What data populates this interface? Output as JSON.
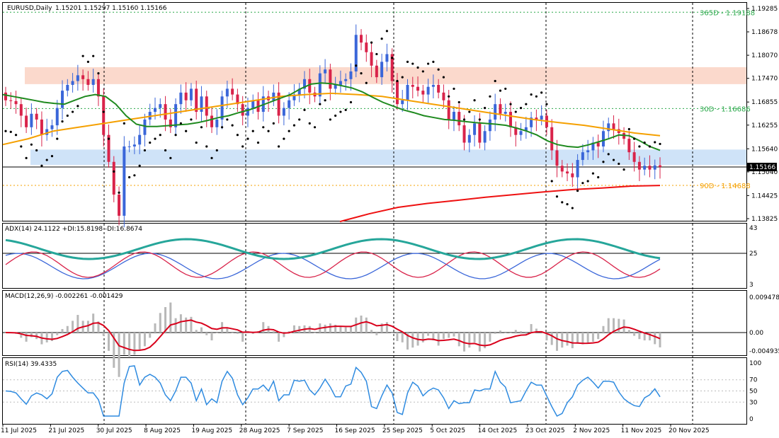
{
  "header": {
    "symbol_label": "EURUSD,Daily",
    "ohlc": "1.15201 1.15297 1.15160 1.15166"
  },
  "colors": {
    "bull": "#3a66d9",
    "bear": "#d9234a",
    "ma_green": "#1f8a1f",
    "ma_orange": "#f5a000",
    "ma_red": "#e11",
    "sar": "#000000",
    "zone_red": "#fbd9cc",
    "zone_blue": "#cfe3f8",
    "adx": "#26a69a",
    "plus_di": "#d9234a",
    "minus_di": "#3a66d9",
    "macd_hist": "#b8b8b8",
    "macd_signal": "#d9001b",
    "rsi": "#2f8be0",
    "level_365": "#2aa84a",
    "level_30": "#2aa84a",
    "level_90": "#f5a000"
  },
  "price_axis": {
    "ticks": [
      "1.19285",
      "1.18678",
      "1.18070",
      "1.17470",
      "1.16855",
      "1.16255",
      "1.15640",
      "1.15040",
      "1.14425",
      "1.13825"
    ],
    "current_price": "1.15166"
  },
  "levels": [
    {
      "label": "365D - 1.19188",
      "value": 1.19188,
      "color": "#2aa84a"
    },
    {
      "label": "30D - 1.16686",
      "value": 1.16686,
      "color": "#2aa84a"
    },
    {
      "label": "90D - 1.14688",
      "value": 1.14688,
      "color": "#f5a000"
    }
  ],
  "zones": [
    {
      "name": "resistance",
      "from": 1.1732,
      "to": 1.1776
    },
    {
      "name": "support",
      "from": 1.1522,
      "to": 1.1562
    }
  ],
  "x_axis": {
    "dates": [
      "11 Jul 2025",
      "21 Jul 2025",
      "30 Jul 2025",
      "8 Aug 2025",
      "19 Aug 2025",
      "28 Aug 2025",
      "7 Sep 2025",
      "16 Sep 2025",
      "25 Sep 2025",
      "5 Oct 2025",
      "14 Oct 2025",
      "23 Oct 2025",
      "2 Nov 2025",
      "11 Nov 2025",
      "20 Nov 2025"
    ]
  },
  "adx_panel": {
    "label": "ADX(14) 24.1122 +DI:15.8198 -DI:16.8674",
    "ticks": [
      "43",
      "25",
      "3"
    ]
  },
  "macd_panel": {
    "label": "MACD(12,26,9) -0.002261 -0.001429",
    "ticks": [
      "0.009478",
      "0.00",
      "-0.004935"
    ]
  },
  "rsi_panel": {
    "label": "RSI(14) 39.4335",
    "ticks": [
      "100",
      "70",
      "50",
      "30",
      "0"
    ]
  },
  "chart_data": {
    "type": "candlestick",
    "symbol": "EURUSD",
    "timeframe": "Daily",
    "ohlc_last": {
      "open": 1.15201,
      "high": 1.15297,
      "low": 1.1516,
      "close": 1.15166
    },
    "close": [
      1.169,
      1.1688,
      1.168,
      1.165,
      1.162,
      1.1655,
      1.164,
      1.16,
      1.1615,
      1.1625,
      1.167,
      1.1715,
      1.173,
      1.174,
      1.1755,
      1.1745,
      1.173,
      1.1745,
      1.17,
      1.16,
      1.153,
      1.1445,
      1.139,
      1.157,
      1.157,
      1.1575,
      1.16,
      1.164,
      1.166,
      1.167,
      1.168,
      1.164,
      1.162,
      1.168,
      1.171,
      1.169,
      1.172,
      1.166,
      1.17,
      1.165,
      1.162,
      1.164,
      1.17,
      1.172,
      1.1705,
      1.168,
      1.165,
      1.167,
      1.169,
      1.166,
      1.17,
      1.169,
      1.171,
      1.165,
      1.167,
      1.169,
      1.1705,
      1.172,
      1.1745,
      1.171,
      1.17,
      1.176,
      1.177,
      1.172,
      1.173,
      1.174,
      1.1745,
      1.1765,
      1.186,
      1.184,
      1.1815,
      1.178,
      1.175,
      1.179,
      1.181,
      1.174,
      1.168,
      1.169,
      1.173,
      1.1725,
      1.1715,
      1.1705,
      1.1725,
      1.173,
      1.171,
      1.169,
      1.164,
      1.166,
      1.1625,
      1.158,
      1.16,
      1.163,
      1.158,
      1.161,
      1.164,
      1.168,
      1.1655,
      1.166,
      1.162,
      1.16,
      1.161,
      1.162,
      1.1645,
      1.164,
      1.165,
      1.162,
      1.156,
      1.152,
      1.1505,
      1.15,
      1.149,
      1.1535,
      1.1555,
      1.156,
      1.158,
      1.157,
      1.161,
      1.163,
      1.1615,
      1.1605,
      1.159,
      1.1555,
      1.153,
      1.151,
      1.152,
      1.151,
      1.1521,
      1.15166
    ],
    "sma_green": [
      1.1705,
      1.17,
      1.1695,
      1.169,
      1.1685,
      1.1682,
      1.168,
      1.169,
      1.17,
      1.1705,
      1.17,
      1.168,
      1.165,
      1.1628,
      1.1622,
      1.1622,
      1.1624,
      1.1626,
      1.1628,
      1.1632,
      1.1638,
      1.1645,
      1.165,
      1.1658,
      1.1665,
      1.1675,
      1.1685,
      1.1695,
      1.1705,
      1.172,
      1.1732,
      1.1735,
      1.1733,
      1.1728,
      1.1722,
      1.1712,
      1.1698,
      1.1685,
      1.1675,
      1.1665,
      1.1658,
      1.165,
      1.1645,
      1.164,
      1.1638,
      1.1635,
      1.1632,
      1.163,
      1.1628,
      1.1625,
      1.1618,
      1.161,
      1.16,
      1.1585,
      1.1575,
      1.157,
      1.1568,
      1.1574,
      1.1582,
      1.159,
      1.16,
      1.1598,
      1.1585,
      1.157,
      1.156
    ],
    "sma_orange": [
      1.1575,
      1.159,
      1.161,
      1.162,
      1.163,
      1.164,
      1.165,
      1.166,
      1.167,
      1.168,
      1.169,
      1.17,
      1.1705,
      1.1708,
      1.1705,
      1.17,
      1.169,
      1.168,
      1.167,
      1.166,
      1.165,
      1.164,
      1.1632,
      1.1625,
      1.1615,
      1.1605,
      1.1598
    ],
    "sma_red": [
      1.1375,
      1.1395,
      1.1412,
      1.1422,
      1.143,
      1.1438,
      1.1445,
      1.1452,
      1.1458,
      1.1462,
      1.1467,
      1.14688
    ],
    "rsi_last": 39.4335,
    "adx_last": {
      "adx": 24.1122,
      "plus_di": 15.8198,
      "minus_di": 16.8674
    },
    "macd_last": {
      "main": -0.002261,
      "signal": -0.001429
    },
    "ylim": [
      1.13825,
      1.19285
    ]
  }
}
